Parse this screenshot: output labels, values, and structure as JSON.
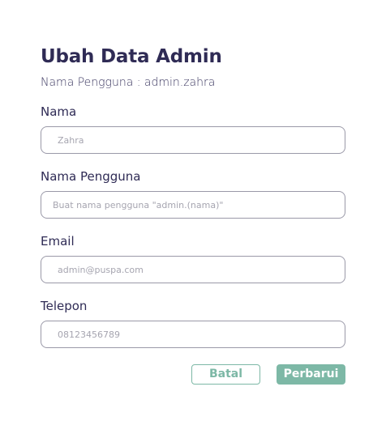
{
  "form": {
    "title": "Ubah Data Admin",
    "subtitle": "Nama Pengguna : admin.zahra"
  },
  "fields": {
    "nama": {
      "label": "Nama",
      "value": "",
      "placeholder": "Zahra"
    },
    "nama_pengguna": {
      "label": "Nama Pengguna",
      "value": "",
      "placeholder": "Buat nama pengguna \"admin.(nama)\""
    },
    "email": {
      "label": "Email",
      "value": "",
      "placeholder": "admin@puspa.com"
    },
    "telepon": {
      "label": "Telepon",
      "value": "",
      "placeholder": "08123456789"
    }
  },
  "actions": {
    "cancel_label": "Batal",
    "submit_label": "Perbarui"
  },
  "colors": {
    "primary_text": "#2f2b55",
    "accent": "#7db8a6",
    "input_border": "#9a99a8",
    "placeholder": "#a6a5b0"
  }
}
